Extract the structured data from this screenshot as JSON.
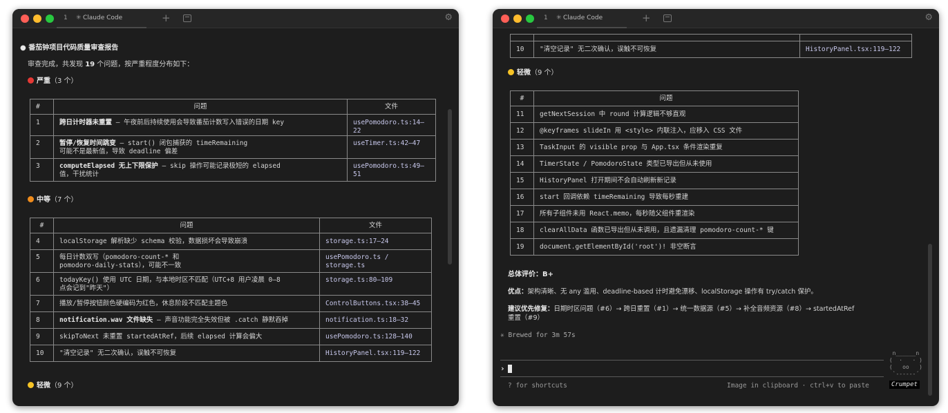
{
  "colors": {
    "window_bg": "#1d1d1d",
    "critical": "#e53935",
    "medium": "#f08c1c",
    "minor": "#f6c326"
  },
  "window": {
    "tab_number": "1",
    "tab_spark": "✳",
    "tab_title": "Claude Code",
    "new_tab": "+",
    "settings_icon": "gear-icon"
  },
  "report": {
    "title": "番茄钟项目代码质量审查报告",
    "summary_pre": "审查完成，共发现 ",
    "summary_count": "19",
    "summary_post": " 个问题，按严重程度分布如下：",
    "critical_label": "严重",
    "critical_count": "（3 个）",
    "medium_label": "中等",
    "medium_count": "（7 个）",
    "minor_label": "轻微",
    "minor_count": "（9 个）"
  },
  "table_headers": {
    "num": "#",
    "issue": "问题",
    "file": "文件"
  },
  "critical": [
    {
      "n": "1",
      "bold": "跨日计时器未重置",
      "rest": " — 午夜前后持续使用会导致番茄计数写入错误的日期 key",
      "file": "usePomodoro.ts:14–22"
    },
    {
      "n": "2",
      "bold": "暂停/恢复时间跳变",
      "rest": " — start() 闭包捕获的 timeRemaining",
      "rest2": "可能不是最新值，导致 deadline 偏差",
      "file": "useTimer.ts:42–47"
    },
    {
      "n": "3",
      "bold": "computeElapsed 无上下限保护",
      "rest": " — skip 操作可能记录极短的 elapsed",
      "rest2": "值，干扰统计",
      "file": "usePomodoro.ts:49–51"
    }
  ],
  "medium": [
    {
      "n": "4",
      "text": "localStorage 解析缺少 schema 校验，数据损坏会导致崩溃",
      "file": "storage.ts:17–24"
    },
    {
      "n": "5",
      "text": "每日计数双写（pomodoro-count-* 和",
      "text2": "pomodoro-daily-stats），可能不一致",
      "file": "usePomodoro.ts /",
      "file2": "storage.ts"
    },
    {
      "n": "6",
      "text": "todayKey() 使用 UTC 日期，与本地时区不匹配（UTC+8 用户凌晨 0–8",
      "text2": "点会记到\"昨天\"）",
      "file": "storage.ts:80–109"
    },
    {
      "n": "7",
      "text": "播放/暂停按钮颜色硬编码为红色，休息阶段不匹配主题色",
      "file": "ControlButtons.tsx:38–45"
    },
    {
      "n": "8",
      "bold": "notification.wav 文件缺失",
      "text": " — 声音功能完全失效但被 .catch 静默吞掉",
      "file": "notification.ts:18–32"
    },
    {
      "n": "9",
      "text": "skipToNext 未重置 startedAtRef，后续 elapsed 计算会偏大",
      "file": "usePomodoro.ts:128–140"
    },
    {
      "n": "10",
      "text": "\"清空记录\" 无二次确认，误触不可恢复",
      "file": "HistoryPanel.tsx:119–122"
    }
  ],
  "minor": [
    {
      "n": "11",
      "text": "getNextSession 中 round 计算逻辑不够直观"
    },
    {
      "n": "12",
      "text": "@keyframes slideIn 用 <style> 内联注入，应移入 CSS 文件"
    },
    {
      "n": "13",
      "text": "TaskInput 的 visible prop 与 App.tsx 条件渲染重复"
    },
    {
      "n": "14",
      "text": "TimerState / PomodoroState 类型已导出但从未使用"
    },
    {
      "n": "15",
      "text": "HistoryPanel 打开期间不会自动刷新新记录"
    },
    {
      "n": "16",
      "text": "start 回调依赖 timeRemaining 导致每秒重建"
    },
    {
      "n": "17",
      "text": "所有子组件未用 React.memo，每秒随父组件重渲染"
    },
    {
      "n": "18",
      "text": "clearAllData 函数已导出但从未调用，且遗漏清理 pomodoro-count-* 键"
    },
    {
      "n": "19",
      "text": "document.getElementById('root')! 非空断言"
    }
  ],
  "conclusion": {
    "overall_label": "总体评价：",
    "overall_value": "B+",
    "pros_label": "优点：",
    "pros_text": "架构清晰、无 any 滥用、deadline-based 计时避免漂移、localStorage 操作有 try/catch 保护。",
    "fix_label": "建议优先修复：",
    "fix_text": "日期时区问题（#6）→ 跨日重置（#1）→ 统一数据源（#5）→ 补全音频资源（#8）→ startedAtRef",
    "fix_text2": "重置（#9）"
  },
  "status": {
    "brewed": "✳ Brewed for 3m 57s",
    "prompt": "›",
    "shortcuts": "? for shortcuts",
    "clipboard": "Image in clipboard · ctrl+v to paste",
    "mascot_name": "Crumpet",
    "mascot_art": "  n______n\n (  ·   · )\n (   oo   )\n  `------´"
  }
}
